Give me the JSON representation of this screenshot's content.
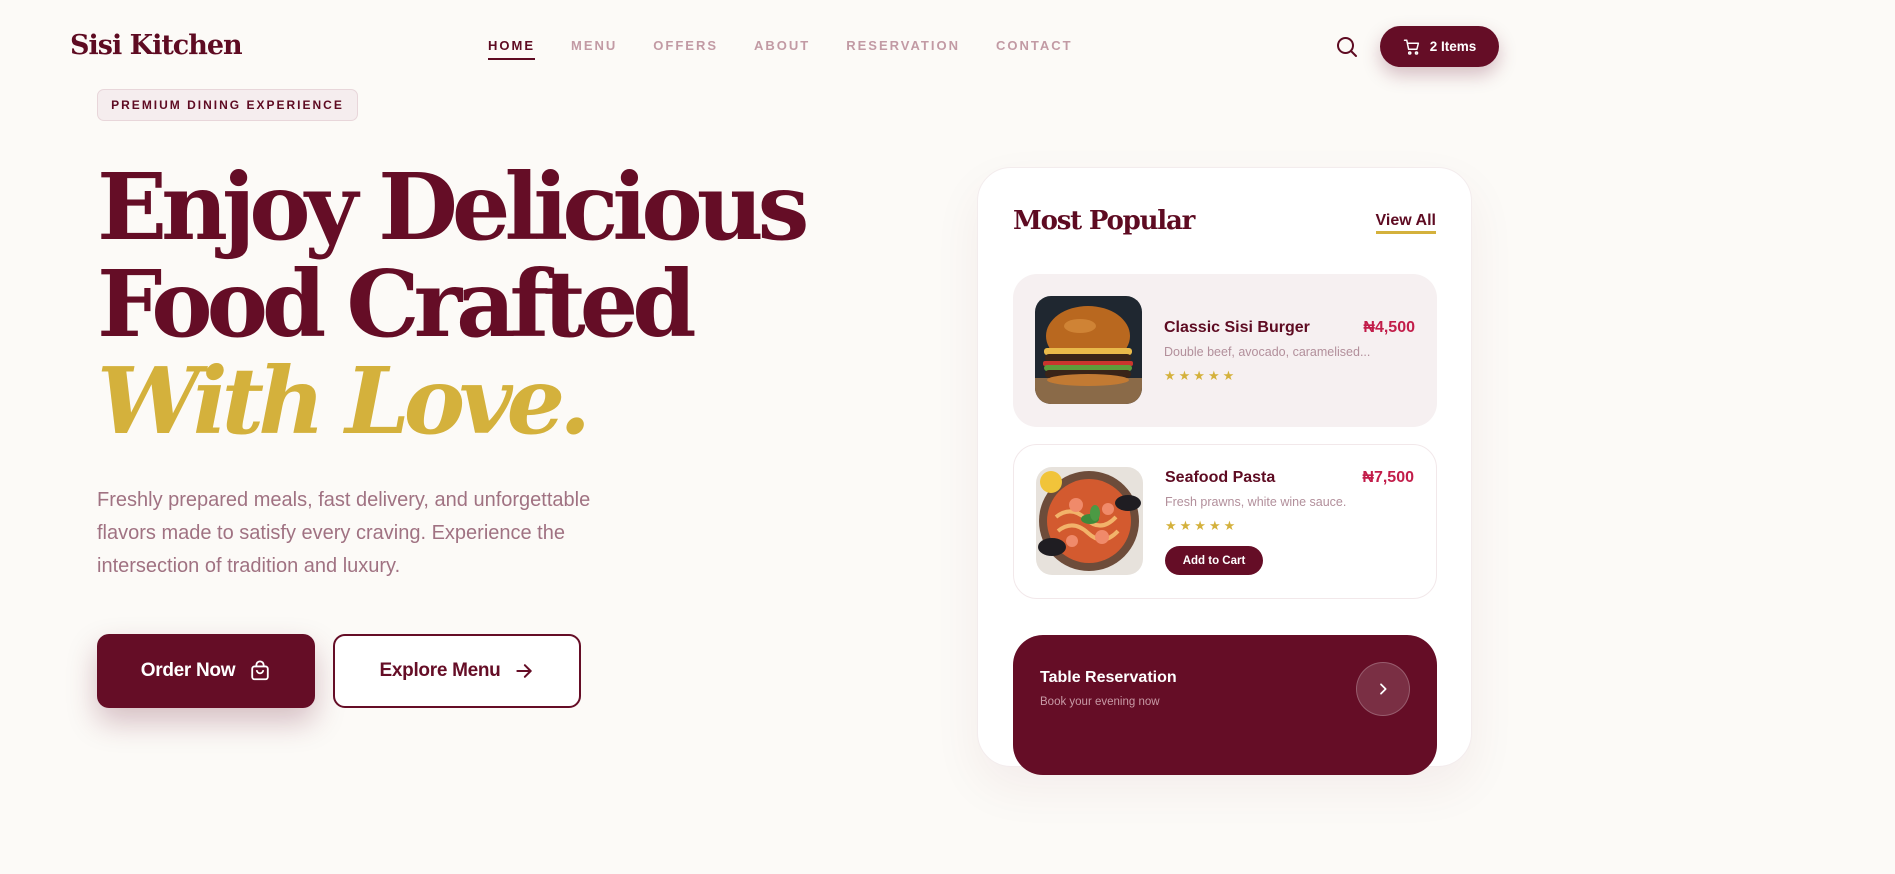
{
  "brand": {
    "name": "Sisi Kitchen"
  },
  "nav": {
    "items": [
      {
        "label": "HOME",
        "active": true
      },
      {
        "label": "MENU",
        "active": false
      },
      {
        "label": "OFFERS",
        "active": false
      },
      {
        "label": "ABOUT",
        "active": false
      },
      {
        "label": "RESERVATION",
        "active": false
      },
      {
        "label": "CONTACT",
        "active": false
      }
    ]
  },
  "header": {
    "search_icon": "search-icon",
    "cart_icon": "cart-icon",
    "cart_label": "2 Items"
  },
  "hero": {
    "badge": "PREMIUM DINING EXPERIENCE",
    "title_line1": "Enjoy Delicious",
    "title_line2": "Food Crafted",
    "title_line3": "With Love.",
    "description": "Freshly prepared meals, fast delivery, and unforgettable flavors made to satisfy every craving. Experience the intersection of tradition and luxury.",
    "order_button": "Order Now",
    "explore_button": "Explore Menu"
  },
  "popular": {
    "title": "Most Popular",
    "view_all": "View All",
    "items": [
      {
        "name": "Classic Sisi Burger",
        "price": "₦4,500",
        "description": "Double beef, avocado, caramelised...",
        "rating": 5,
        "stars": "★★★★★"
      },
      {
        "name": "Seafood Pasta",
        "price": "₦7,500",
        "description": "Fresh prawns, white wine sauce.",
        "rating": 5,
        "stars": "★★★★★",
        "cta": "Add to Cart"
      }
    ]
  },
  "reservation": {
    "title": "Table Reservation",
    "subtitle": "Book your evening now"
  },
  "colors": {
    "primary": "#650d26",
    "accent": "#d4b13c",
    "price": "#c21d4a",
    "background": "#fcfaf7"
  }
}
